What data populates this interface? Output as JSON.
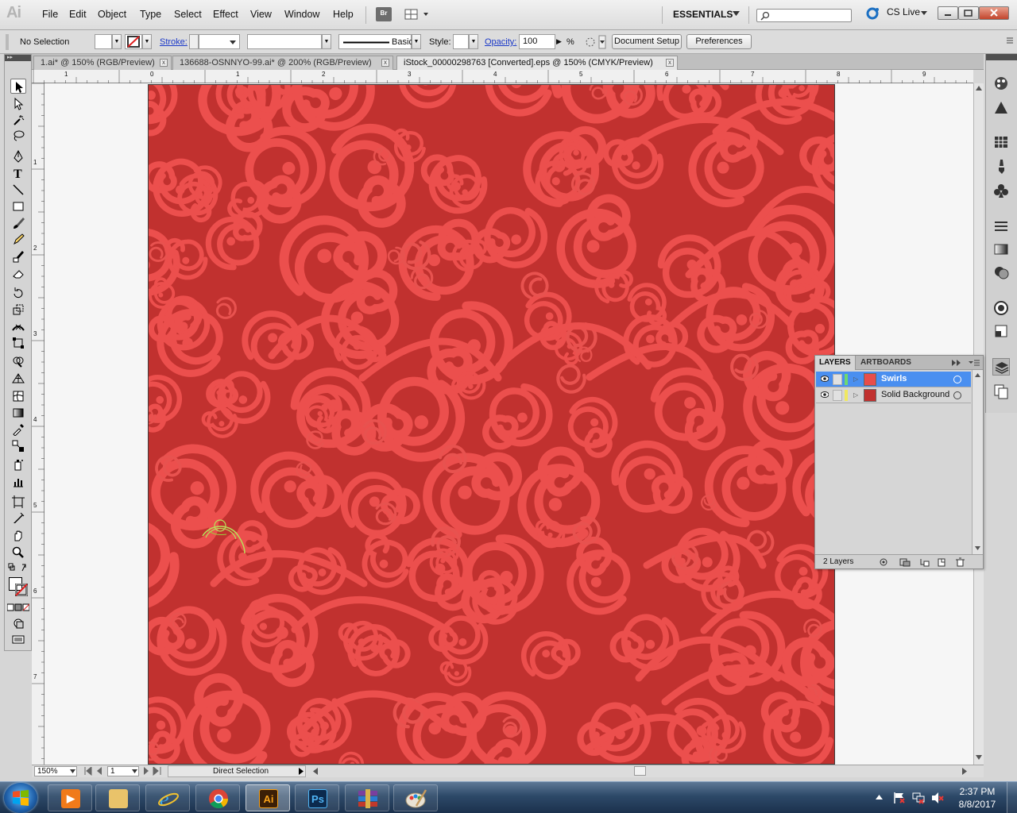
{
  "app": {
    "logo": "Ai",
    "bridge_label": "Br"
  },
  "menu": {
    "items": [
      "File",
      "Edit",
      "Object",
      "Type",
      "Select",
      "Effect",
      "View",
      "Window",
      "Help"
    ]
  },
  "workspace": {
    "name": "ESSENTIALS",
    "cslive": "CS Live"
  },
  "control_bar": {
    "selection": "No Selection",
    "stroke_label": "Stroke:",
    "brush_label": "Basic",
    "style_label": "Style:",
    "opacity_label": "Opacity:",
    "opacity_value": "100",
    "opacity_unit": "%",
    "document_setup": "Document Setup",
    "preferences": "Preferences"
  },
  "tabs": [
    {
      "label": "1.ai* @ 150% (RGB/Preview)",
      "close": "x"
    },
    {
      "label": "136688-OSNNYO-99.ai* @ 200% (RGB/Preview)",
      "close": "x"
    },
    {
      "label": "iStock_00000298763 [Converted].eps @ 150% (CMYK/Preview)",
      "close": "x"
    }
  ],
  "ruler": {
    "top": [
      "1",
      "0",
      "1",
      "2",
      "3",
      "4",
      "5",
      "6",
      "7",
      "8",
      "9"
    ],
    "left": [
      "1",
      "2",
      "3",
      "4",
      "5",
      "6",
      "7"
    ]
  },
  "status": {
    "zoom": "150%",
    "artboard": "1",
    "tool": "Direct Selection"
  },
  "layers_panel": {
    "tabs": [
      "LAYERS",
      "ARTBOARDS"
    ],
    "layers": [
      {
        "name": "Swirls",
        "color": "#e84d4a",
        "stripe": "#6fd86f",
        "selected": true
      },
      {
        "name": "Solid Background",
        "color": "#c1312f",
        "stripe": "#f0e860",
        "selected": false
      }
    ],
    "count": "2 Layers"
  },
  "taskbar": {
    "apps": [
      "media-player",
      "file-explorer",
      "internet-explorer",
      "chrome",
      "illustrator",
      "photoshop",
      "winrar",
      "paint"
    ],
    "illustrator_label": "Ai",
    "photoshop_label": "Ps",
    "time": "2:37 PM",
    "date": "8/8/2017"
  },
  "colors": {
    "artboard_bg": "#c1312f",
    "swirl": "#ec4f4d",
    "selection_path": "#b9e05a"
  }
}
